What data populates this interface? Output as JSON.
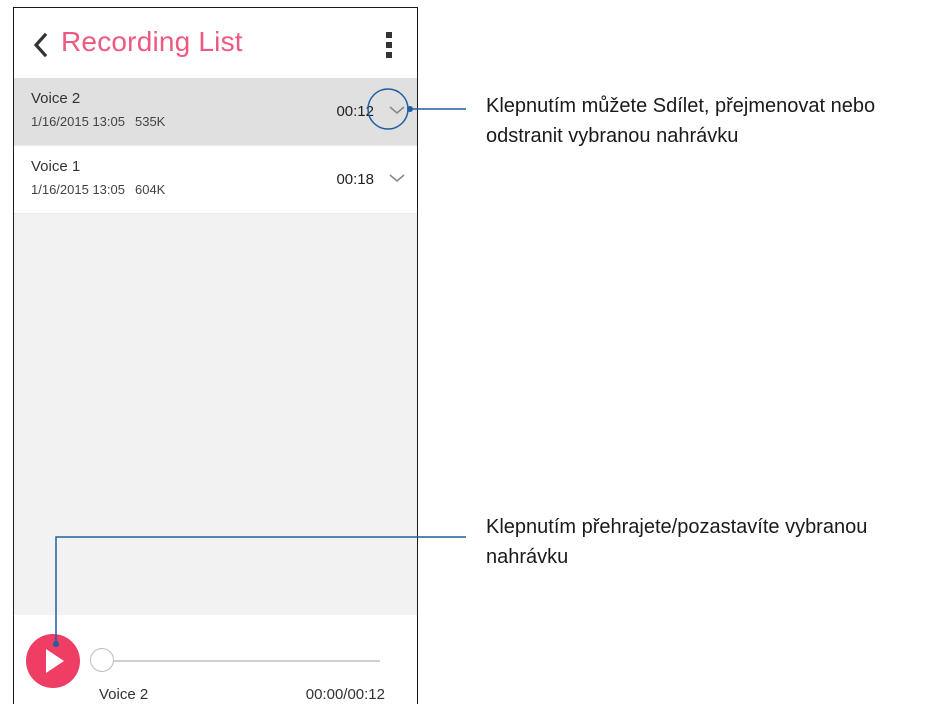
{
  "app": {
    "title": "Recording List"
  },
  "recordings": [
    {
      "name": "Voice 2",
      "date": "1/16/2015 13:05",
      "size": "535K",
      "duration": "00:12",
      "selected": true
    },
    {
      "name": "Voice 1",
      "date": "1/16/2015 13:05",
      "size": "604K",
      "duration": "00:18",
      "selected": false
    }
  ],
  "player": {
    "track_name": "Voice 2",
    "time": "00:00/00:12",
    "progress": 0
  },
  "annotations": {
    "more_options": "Klepnutím můžete Sdílet, přejmenovat nebo odstranit vybranou nahrávku",
    "play_pause": "Klepnutím přehrajete/pozastavíte vybranou nahrávku"
  },
  "colors": {
    "accent": "#ee5a7f",
    "play_button": "#ee3e64",
    "callout_line": "#1f5fa0"
  },
  "icons": {
    "back": "chevron-left-icon",
    "menu": "more-vertical-icon",
    "expand": "chevron-down-icon",
    "play": "play-icon"
  }
}
